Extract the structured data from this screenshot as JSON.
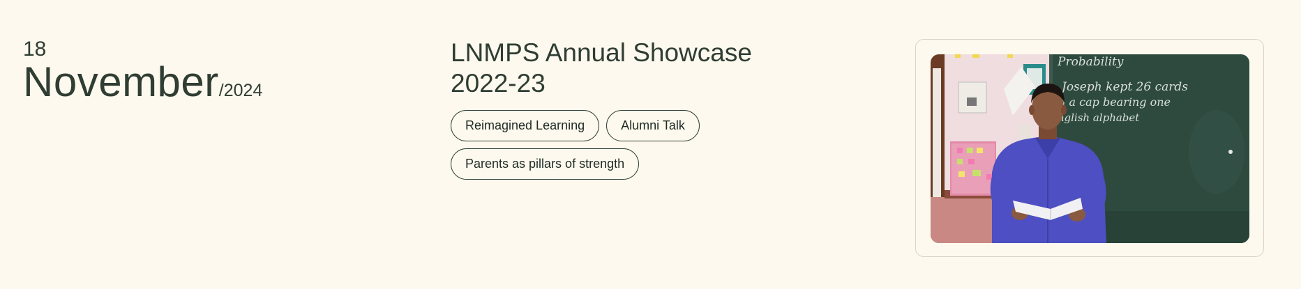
{
  "event": {
    "date": {
      "day": "18",
      "month": "November",
      "year": "/2024"
    },
    "title_line1": "LNMPS Annual Showcase",
    "title_line2": "2022-23",
    "tags": [
      "Reimagined Learning",
      "Alumni Talk",
      "Parents as pillars of strength"
    ],
    "photo": {
      "chalkboard_text": [
        "Probability",
        "Joseph kept 26 cards",
        "in a cap bearing one",
        "english alphabet"
      ],
      "colors": {
        "chalkboard": "#2e4a3e",
        "shirt": "#4d4fc2",
        "wall": "#f0dde0",
        "background": "#fdf9ee"
      }
    }
  }
}
